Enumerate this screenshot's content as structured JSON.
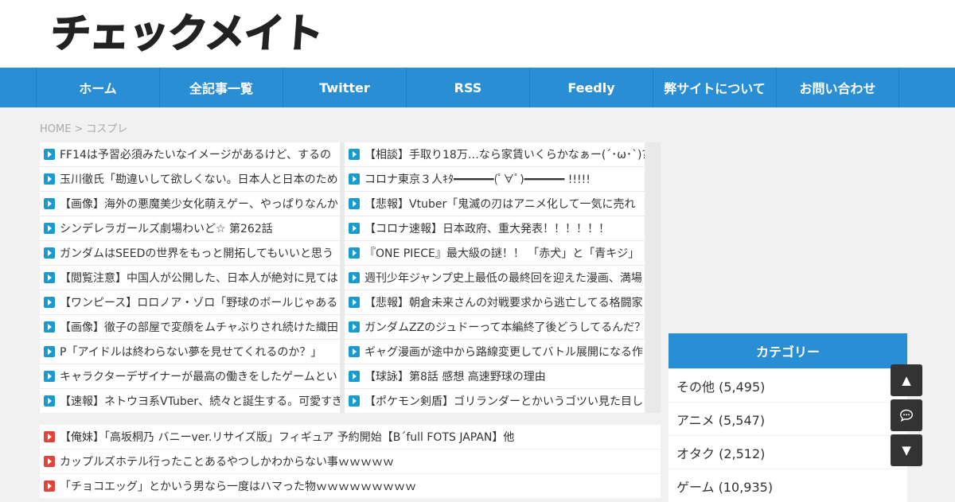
{
  "site": {
    "logo": "チェックメイト"
  },
  "nav": {
    "items": [
      "ホーム",
      "全記事一覧",
      "Twitter",
      "RSS",
      "Feedly",
      "弊サイトについて",
      "お問い合わせ"
    ]
  },
  "breadcrumb": {
    "home": "HOME",
    "separator": ">",
    "current": "コスプレ"
  },
  "feed": {
    "left": [
      "FF14は予習必須みたいなイメージがあるけど、するの",
      "玉川徹氏「勘違いして欲しくない。日本人と日本のため",
      "【画像】海外の悪魔美少女化萌えゲー、やっぱりなんか",
      "シンデレラガールズ劇場わいど☆ 第262話",
      "ガンダムはSEEDの世界をもっと開拓してもいいと思う",
      "【閲覧注意】中国人が公開した、日本人が絶対に見ては",
      "【ワンピース】ロロノア・ゾロ「野球のボールじゃある",
      "【画像】徹子の部屋で変顔をムチャぶりされ続けた織田",
      "P「アイドルは終わらない夢を見せてくれるのか？」",
      "キャラクターデザイナーが最高の働きをしたゲームとい",
      "【速報】ネトウヨ系VTuber、続々と誕生する。可愛すぎ"
    ],
    "right": [
      "【相談】手取り18万…なら家賃いくらかなぁー(´･ω･`)?",
      "コロナ東京３人ｷﾀ━━━━━━(ﾟ∀ﾟ)━━━━━━ !!!!!",
      "【悲報】Vtuber「鬼滅の刃はアニメ化して一気に売れ",
      "【コロナ速報】日本政府、重大発表！！！！！！",
      "『ONE PIECE』最大級の謎！！ 「赤犬」と「青キジ」",
      "週刊少年ジャンプ史上最低の最終回を迎えた漫画、満場",
      "【悲報】朝倉未来さんの対戦要求から逃亡してる格闘家",
      "ガンダムZZのジュドーって本編終了後どうしてるんだ？",
      "ギャグ漫画が途中から路線変更してバトル展開になる作",
      "【球詠】第8話 感想 高速野球の理由",
      "【ポケモン剣盾】ゴリランダーとかいうゴツい見た目し"
    ]
  },
  "news": [
    "【俺妹】「高坂桐乃 バニーver.リサイズ版」フィギュア 予約開始【B´full FOTS JAPAN】他",
    "カップルズホテル行ったことあるやつしかわからない事ｗｗｗｗｗ",
    "「チョコエッグ」とかいう男なら一度はハマった物ｗｗｗｗｗｗｗｗｗ"
  ],
  "categories": {
    "title": "カテゴリー",
    "items": [
      "その他 (5,495)",
      "アニメ (5,547)",
      "オタク (2,512)",
      "ゲーム (10,935)"
    ]
  },
  "floating": {
    "up": "▲",
    "down": "▼",
    "comment_icon": "comment-icon"
  },
  "colors": {
    "nav_bg": "#2a8ed4",
    "play_blue": "#1a9bcf",
    "play_red": "#e2433a"
  }
}
